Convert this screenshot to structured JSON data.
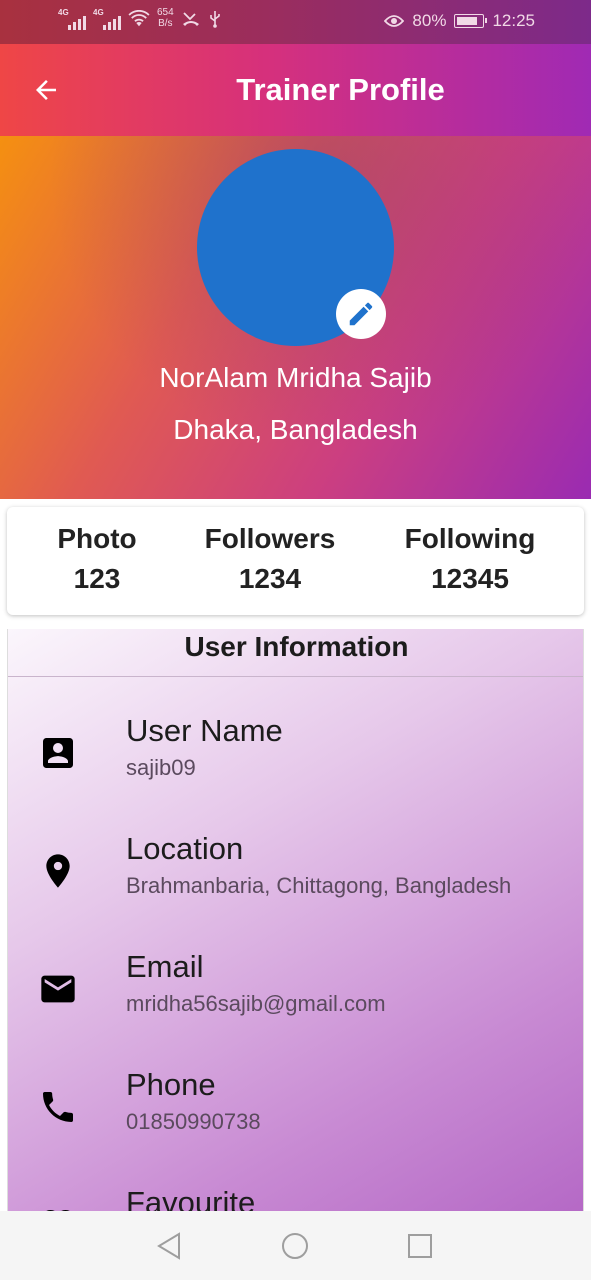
{
  "status_bar": {
    "net_type_1": "4G",
    "net_type_2": "4G",
    "net_speed_value": "654",
    "net_speed_unit": "B/s",
    "battery": "80%",
    "time": "12:25"
  },
  "app_bar": {
    "title": "Trainer Profile"
  },
  "profile": {
    "name": "NorAlam Mridha Sajib",
    "location": "Dhaka, Bangladesh",
    "avatar_color": "#1f72cc"
  },
  "stats": [
    {
      "label": "Photo",
      "value": "123"
    },
    {
      "label": "Followers",
      "value": "1234"
    },
    {
      "label": "Following",
      "value": "12345"
    }
  ],
  "user_information": {
    "title": "User Information",
    "items": [
      {
        "icon": "account-box-icon",
        "label": "User Name",
        "value": "sajib09"
      },
      {
        "icon": "location-pin-icon",
        "label": "Location",
        "value": "Brahmanbaria, Chittagong, Bangladesh"
      },
      {
        "icon": "email-icon",
        "label": "Email",
        "value": "mridha56sajib@gmail.com"
      },
      {
        "icon": "phone-icon",
        "label": "Phone",
        "value": "01850990738"
      },
      {
        "icon": "heart-icon",
        "label": "Favourite",
        "value": ""
      }
    ]
  },
  "nav_bar": {
    "buttons": [
      "back-triangle-icon",
      "home-circle-icon",
      "recents-square-icon"
    ]
  }
}
